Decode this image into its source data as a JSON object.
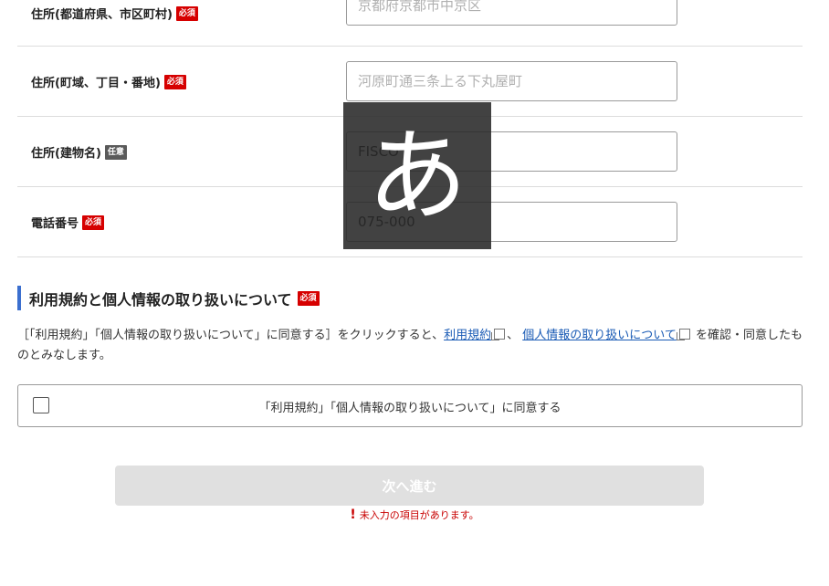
{
  "form": {
    "rows": [
      {
        "label": "住所(都道府県、市区町村)",
        "badge": "必須",
        "placeholder": "京都府京都市中京区",
        "value": ""
      },
      {
        "label": "住所(町域、丁目・番地)",
        "badge": "必須",
        "placeholder": "河原町通三条上る下丸屋町",
        "value": ""
      },
      {
        "label": "住所(建物名)",
        "badge": "任意",
        "placeholder": "",
        "value": "FISCO"
      },
      {
        "label": "電話番号",
        "badge": "必須",
        "placeholder": "",
        "value": "075-000"
      }
    ]
  },
  "terms": {
    "title": "利用規約と個人情報の取り扱いについて",
    "badge": "必須",
    "notice_before": "［「利用規約」「個人情報の取り扱いについて」に同意する］をクリックすると、",
    "link1": "利用規約",
    "separator": "、",
    "link2": "個人情報の取り扱いについて",
    "notice_after": "を確認・同意したものとみなします。",
    "checkbox_label": "「利用規約」「個人情報の取り扱いについて」に同意する"
  },
  "actions": {
    "next_label": "次へ進む",
    "error_text": "未入力の項目があります。"
  },
  "ime_indicator": {
    "char": "あ"
  },
  "colors": {
    "required": "#d60000",
    "optional": "#5a5a5a",
    "accent": "#3b6fcf",
    "link": "#1a5bb5",
    "error": "#c80000"
  }
}
